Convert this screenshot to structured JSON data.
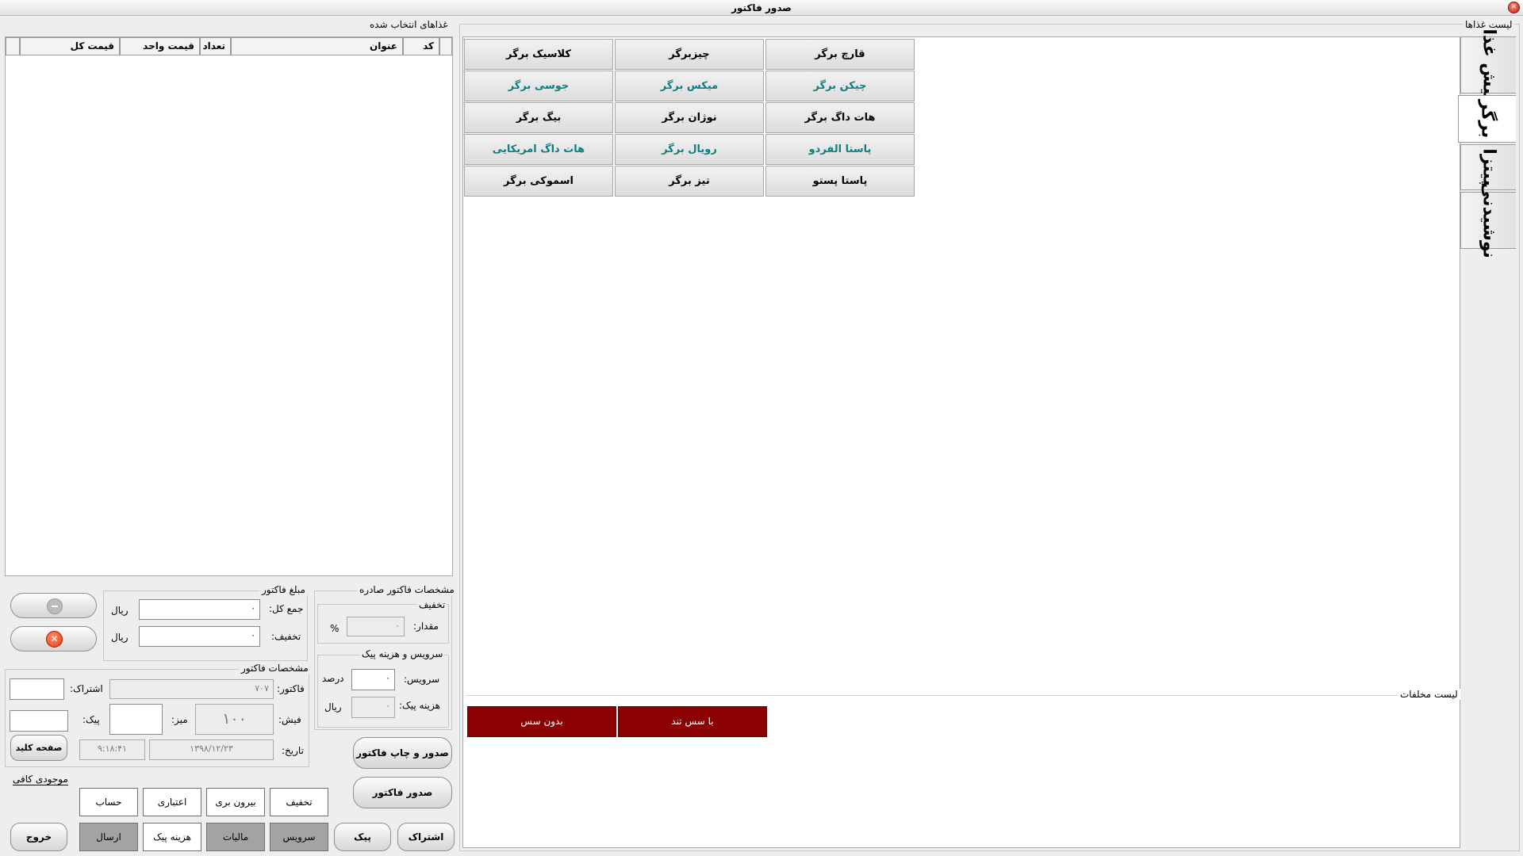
{
  "window": {
    "title": "صدور فاکتور"
  },
  "selected": {
    "title": "غذاهای انتخاب شده",
    "headers": {
      "code": "کد",
      "name": "عنوان",
      "qty": "تعداد",
      "unit": "قیمت واحد",
      "total": "قیمت کل"
    }
  },
  "menu": {
    "title": "لیست غذاها",
    "tabs": [
      "پیش غذا",
      "برگر",
      "پیتزا",
      "نوشیدنی"
    ],
    "items": [
      {
        "label": "قارچ برگر",
        "teal": false
      },
      {
        "label": "چیزبرگر",
        "teal": false
      },
      {
        "label": "کلاسیک برگر",
        "teal": false
      },
      {
        "label": "چیکن برگر",
        "teal": true
      },
      {
        "label": "میکس برگر",
        "teal": true
      },
      {
        "label": "جوسی برگر",
        "teal": true
      },
      {
        "label": "هات داگ برگر",
        "teal": false
      },
      {
        "label": "نوژان برگر",
        "teal": false
      },
      {
        "label": "بیگ برگر",
        "teal": false
      },
      {
        "label": "پاستا الفردو",
        "teal": true
      },
      {
        "label": "رویال برگر",
        "teal": true
      },
      {
        "label": "هات داگ امریکایی",
        "teal": true
      },
      {
        "label": "پاستا پستو",
        "teal": false
      },
      {
        "label": "تیز برگر",
        "teal": false
      },
      {
        "label": "اسموکی برگر",
        "teal": false
      }
    ]
  },
  "extras": {
    "title": "لیست مخلفات",
    "items": [
      "بدون سس",
      "با سس تند"
    ]
  },
  "amount": {
    "title": "مبلغ فاکتور",
    "total_label": "جمع کل:",
    "total": "۰",
    "discount_label": "تخفیف:",
    "discount": "۰",
    "currency": "ریال"
  },
  "issued": {
    "title": "مشخصات فاکتور صادره",
    "discount_title": "تخفیف",
    "amount_label": "مقدار:",
    "amount": "۰",
    "percent": "%",
    "service_title": "سرویس و هزینه پیک",
    "service_label": "سرویس:",
    "service": "۰",
    "service_unit": "درصد",
    "delivery_label": "هزینه پیک:",
    "delivery": "۰",
    "delivery_unit": "ریال"
  },
  "invoice": {
    "title": "مشخصات فاکتور",
    "invoice_label": "فاکتور:",
    "invoice_no": "۷۰۷",
    "sub_label": "اشتراک:",
    "sub": "",
    "receipt_label": "فیش:",
    "receipt": "۱۰۰",
    "table_label": "میز:",
    "table": "",
    "courier_label": "پیک:",
    "courier": "",
    "date_label": "تاریخ:",
    "date": "۱۳۹۸/۱۲/۲۳",
    "time": "۹:۱۸:۴۱"
  },
  "buttons": {
    "keyboard": "صفحه کلید",
    "issue_print": "صدور و چاپ فاکتور",
    "issue": "صدور فاکتور",
    "coffee": "موجودی کافی",
    "exit": "خروج",
    "row1": [
      "تخفیف",
      "بیرون بری",
      "اعتباری",
      "حساب"
    ],
    "row2": [
      "سرویس",
      "مالیات",
      "هزینه پیک",
      "ارسال"
    ],
    "courier": "پیک",
    "subscription": "اشتراک"
  },
  "colors": {
    "teal": "#0e7e7e",
    "extra_bg": "#8b0000",
    "close": "#c51c0d"
  }
}
